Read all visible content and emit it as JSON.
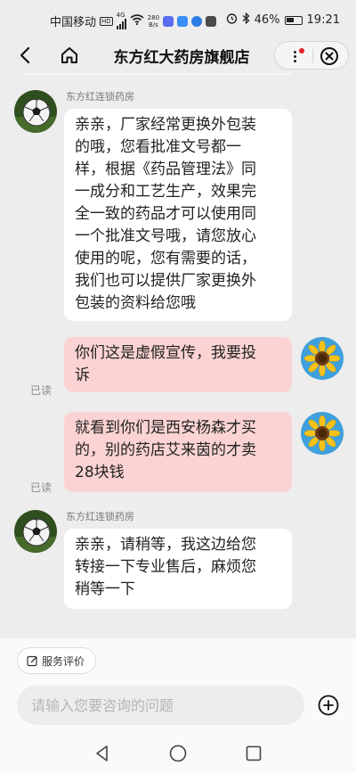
{
  "status_bar": {
    "carrier": "中国移动",
    "hd_label": "HD",
    "net_type": "4G",
    "speed_value": "280",
    "speed_unit": "B/s",
    "battery_percent": "46%",
    "time": "19:21"
  },
  "nav": {
    "title": "东方红大药房旗舰店",
    "back_icon": "chevron-left-icon",
    "home_icon": "home-icon",
    "more_icon": "more-vertical-icon",
    "close_icon": "close-circle-icon"
  },
  "messages": [
    {
      "direction": "incoming",
      "sender": "东方红连锁药房",
      "avatar": "soccer-ball-avatar",
      "lines": [
        "亲亲，厂家经常更换外包装",
        "的哦，您看批准文号都一",
        "样，根据《药品管理法》同",
        "一成分和工艺生产，效果完",
        "全一致的药品才可以使用同",
        "一个批准文号哦，请您放心",
        "使用的呢，您有需要的话，",
        "我们也可以提供厂家更换外",
        "包装的资料给您哦"
      ]
    },
    {
      "direction": "outgoing",
      "avatar": "sunflower-avatar",
      "read_status": "已读",
      "lines": [
        "你们这是虚假宣传，我要投",
        "诉"
      ]
    },
    {
      "direction": "outgoing",
      "avatar": "sunflower-avatar",
      "read_status": "已读",
      "lines": [
        "就看到你们是西安杨森才买",
        "的，别的药店艾来茵的才卖",
        "28块钱"
      ]
    },
    {
      "direction": "incoming",
      "sender": "东方红连锁药房",
      "avatar": "soccer-ball-avatar",
      "lines": [
        "亲亲，请稍等，我这边给您",
        "转接一下专业售后，麻烦您",
        "稍等一下"
      ]
    }
  ],
  "bottom": {
    "rate_button": "服务评价",
    "input_placeholder": "请输入您要咨询的问题",
    "add_icon": "plus-circle-icon"
  },
  "system_nav": {
    "back_icon": "triangle-back-icon",
    "home_icon": "circle-home-icon",
    "recents_icon": "square-recents-icon"
  },
  "colors": {
    "background": "#ededed",
    "incoming_bubble": "#ffffff",
    "outgoing_bubble": "#fbd3d3",
    "read_mark": "#8a8a8a"
  }
}
